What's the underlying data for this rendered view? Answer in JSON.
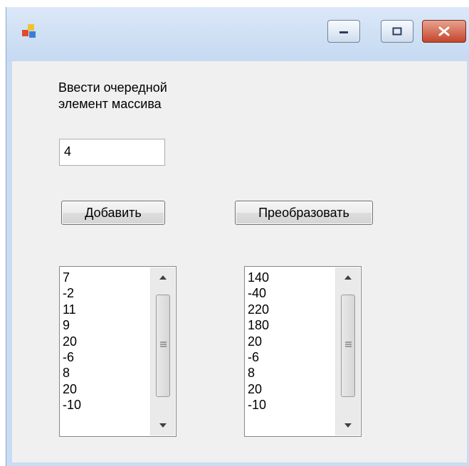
{
  "window": {
    "icon": "app-icon",
    "controls": [
      "minimize-icon",
      "maximize-icon",
      "close-icon"
    ]
  },
  "form": {
    "prompt_label": "Ввести очередной\nэлемент массива",
    "input_value": "4",
    "add_button_label": "Добавить",
    "transform_button_label": "Преобразовать"
  },
  "lists": {
    "source_items": [
      "7",
      "-2",
      "11",
      "9",
      "20",
      "-6",
      "8",
      "20",
      "-10"
    ],
    "result_items": [
      "140",
      "-40",
      "220",
      "180",
      "20",
      "-6",
      "8",
      "20",
      "-10"
    ]
  },
  "colors": {
    "title_bar": "#c5d9f1",
    "client_bg": "#f0f0f0",
    "close_button": "#c4452b"
  }
}
